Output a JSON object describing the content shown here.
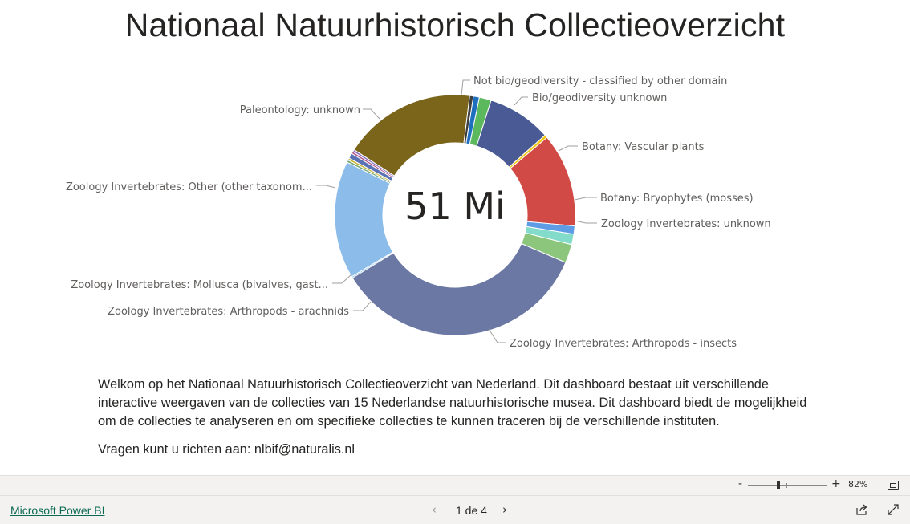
{
  "report": {
    "title": "Nationaal Natuurhistorisch Collectieoverzicht",
    "center_value": "51 Mi",
    "description": "Welkom op het Nationaal Natuurhistorisch Collectieoverzicht van Nederland. Dit dashboard bestaat uit verschillende interactive weergaven van de collecties van 15 Nederlandse natuurhistorische musea. Dit dashboard biedt de mogelijkheid om de collecties te analyseren en om specifieke collecties te kunnen traceren bij de verschillende instituten.",
    "contact": "Vragen kunt u richten aan: nlbif@naturalis.nl"
  },
  "chart_data": {
    "type": "pie",
    "variant": "donut",
    "total_label": "51 Mi",
    "slices": [
      {
        "label": "Not bio/geodiversity - classified by other domain",
        "value": 1.6,
        "color": "#5bb85d"
      },
      {
        "label": "Bio/geodiversity unknown",
        "value": 8.6,
        "color": "#4a5a94"
      },
      {
        "label": "",
        "value": 0.4,
        "color": "#f2c811"
      },
      {
        "label": "Botany: Vascular plants",
        "value": 12.6,
        "color": "#d14a45"
      },
      {
        "label": "Botany: Bryophytes (mosses)",
        "value": 1.1,
        "color": "#5e9de6"
      },
      {
        "label": "",
        "value": 1.4,
        "color": "#83dcca"
      },
      {
        "label": "Zoology Invertebrates: unknown",
        "value": 2.5,
        "color": "#8cc67c"
      },
      {
        "label": "Zoology Invertebrates: Arthropods - insects",
        "value": 34.8,
        "color": "#6b78a3"
      },
      {
        "label": "Zoology Invertebrates: Arthropods - arachnids",
        "value": 0.2,
        "color": "#8cbdea"
      },
      {
        "label": "Zoology Invertebrates: Mollusca (bivalves, gast...",
        "value": 15.8,
        "color": "#8cbdea"
      },
      {
        "label": "",
        "value": 0.3,
        "color": "#6fa371"
      },
      {
        "label": "Zoology Invertebrates: Other (other taxonom...",
        "value": 0.3,
        "color": "#c9b53a"
      },
      {
        "label": "",
        "value": 0.7,
        "color": "#5b73b4"
      },
      {
        "label": "",
        "value": 0.3,
        "color": "#b0558c"
      },
      {
        "label": "",
        "value": 0.3,
        "color": "#8b6fbd"
      },
      {
        "label": "Paleontology: unknown",
        "value": 17.8,
        "color": "#7a651b"
      },
      {
        "label": "",
        "value": 0.5,
        "color": "#3f3f3f"
      },
      {
        "label": "",
        "value": 0.8,
        "color": "#1f6fbf"
      }
    ],
    "start_angle_deg": 11.7
  },
  "zoom": {
    "minus": "-",
    "plus": "+",
    "level": "82%"
  },
  "footer": {
    "powerbi_link": "Microsoft Power BI",
    "page_indicator": "1 de 4",
    "prev_icon": "chevron-left-icon",
    "next_icon": "chevron-right-icon"
  }
}
